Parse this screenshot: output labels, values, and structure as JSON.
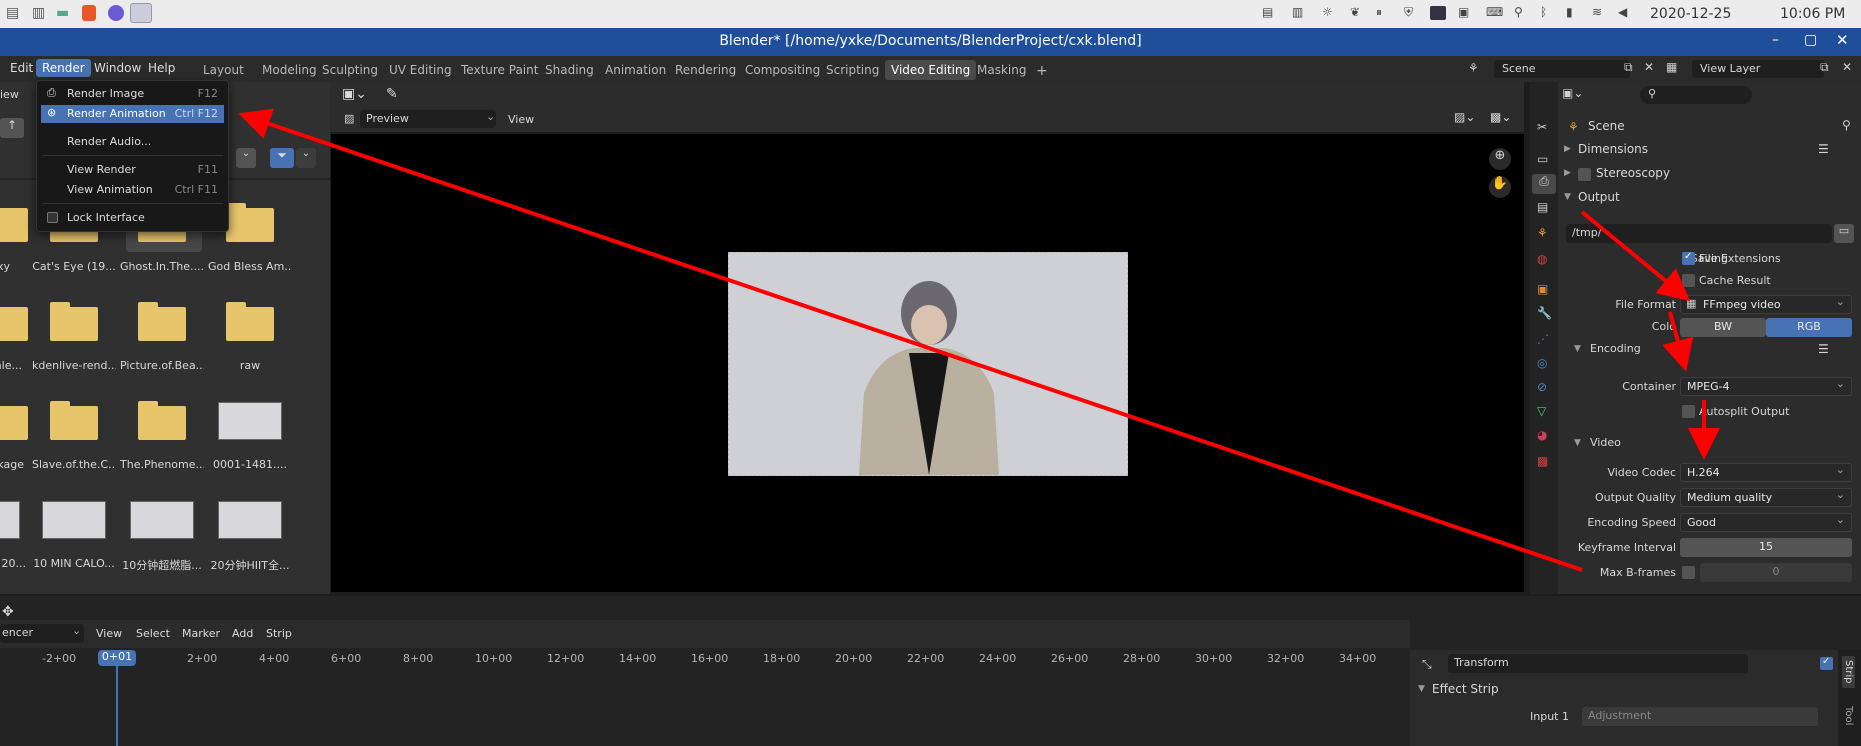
{
  "system_bar": {
    "date": "2020-12-25",
    "time": "10:06 PM"
  },
  "window": {
    "title": "Blender* [/home/yxke/Documents/BlenderProject/cxk.blend]"
  },
  "menubar": {
    "items": [
      "Edit",
      "Render",
      "Window",
      "Help"
    ],
    "workspaces": [
      "Layout",
      "Modeling",
      "Sculpting",
      "UV Editing",
      "Texture Paint",
      "Shading",
      "Animation",
      "Rendering",
      "Compositing",
      "Scripting",
      "Video Editing",
      "Masking"
    ],
    "active_workspace": "Video Editing",
    "scene_value": "Scene",
    "view_layer_value": "View Layer"
  },
  "render_menu": [
    {
      "label": "Render Image",
      "shortcut": "F12"
    },
    {
      "label": "Render Animation",
      "shortcut": "Ctrl F12"
    },
    {
      "label": "Render Audio..."
    },
    {
      "label": "View Render",
      "shortcut": "F11"
    },
    {
      "label": "View Animation",
      "shortcut": "Ctrl F11"
    },
    {
      "label": "Lock Interface"
    }
  ],
  "file_browser": {
    "view_fragment": "iew",
    "row1": [
      "xy",
      "Cat's Eye (19...",
      "Ghost.In.The....",
      "God Bless Am..."
    ],
    "row2": [
      "ale...",
      "kdenlive-rend...",
      "Picture.of.Bea...",
      "raw"
    ],
    "row3": [
      "kage",
      "Slave.of.the.C...",
      "The.Phenome...",
      "0001-1481...."
    ],
    "row4": [
      "20...",
      "10 MIN CALO...",
      "10分钟超燃脂...",
      "20分钟HIIT全..."
    ]
  },
  "viewer": {
    "mode": "Preview",
    "view_menu": "View"
  },
  "properties": {
    "search_placeholder": "",
    "context": "Scene",
    "panels": {
      "dimensions": "Dimensions",
      "stereoscopy": "Stereoscopy",
      "output": "Output",
      "encoding": "Encoding",
      "video": "Video"
    },
    "output_path": "/tmp/",
    "saving_label": "Saving",
    "file_extensions": "File Extensions",
    "cache_result": "Cache Result",
    "file_format_label": "File Format",
    "file_format_value": "FFmpeg video",
    "color_label": "Colo",
    "color_bw": "BW",
    "color_rgb": "RGB",
    "container_label": "Container",
    "container_value": "MPEG-4",
    "autosplit": "Autosplit Output",
    "video_codec_label": "Video Codec",
    "video_codec_value": "H.264",
    "output_quality_label": "Output Quality",
    "output_quality_value": "Medium quality",
    "encoding_speed_label": "Encoding Speed",
    "encoding_speed_value": "Good",
    "keyframe_label": "Keyframe Interval",
    "keyframe_value": "15",
    "max_bframes_label": "Max B-frames",
    "max_bframes_value": "0"
  },
  "timeline": {
    "editor_type": "encer",
    "menus": [
      "View",
      "Select",
      "Marker",
      "Add",
      "Strip"
    ],
    "current_frame": "0+01",
    "ticks": [
      "-2+00",
      "2+00",
      "4+00",
      "6+00",
      "8+00",
      "10+00",
      "12+00",
      "14+00",
      "16+00",
      "18+00",
      "20+00",
      "22+00",
      "24+00",
      "26+00",
      "28+00",
      "30+00",
      "32+00",
      "34+00"
    ]
  },
  "strip_panel": {
    "transform": "Transform",
    "effect_strip": "Effect Strip",
    "input1_label": "Input 1",
    "input1_placeholder": "Adjustment",
    "tabs": [
      "Strip",
      "Tool"
    ]
  },
  "colors": {
    "accent": "#4772b3",
    "titlebar": "#1f4f9a",
    "annotation": "#ff0000"
  }
}
